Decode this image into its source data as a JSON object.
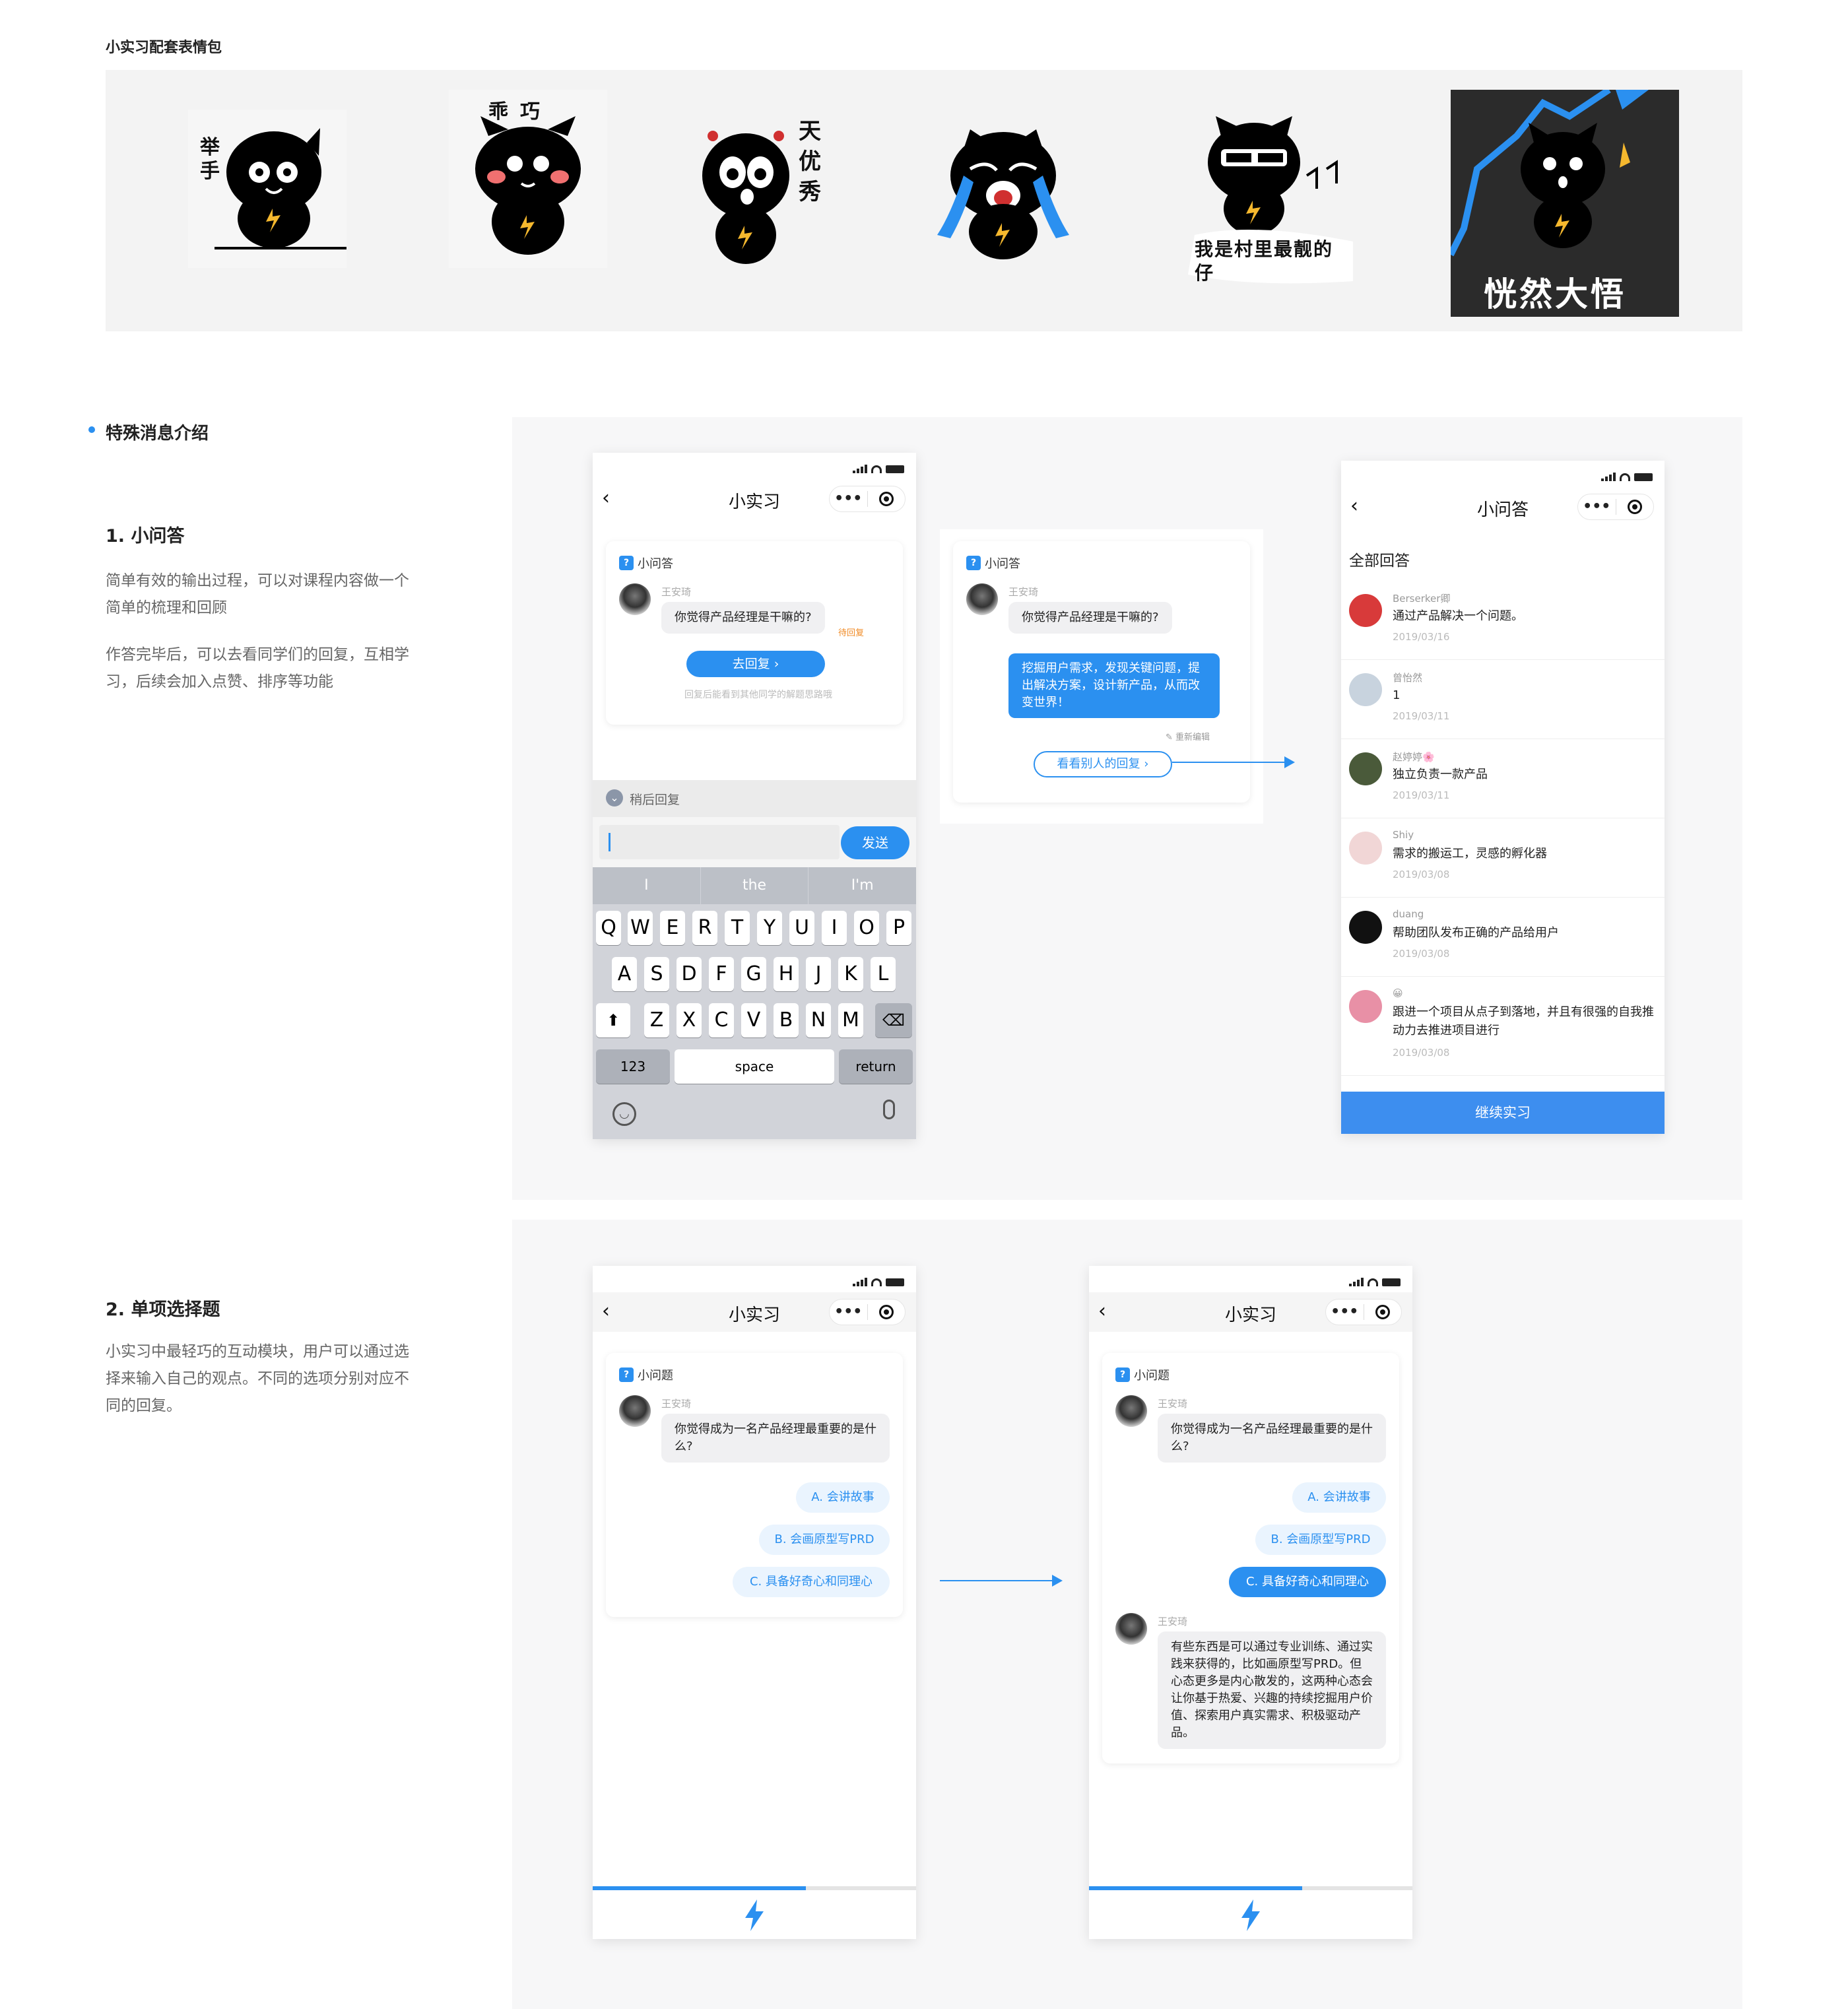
{
  "stickers_section": {
    "title": "小实习配套表情包",
    "captions": [
      "举手",
      "乖巧",
      "天优秀",
      "我是村里最靓的仔",
      "恍然大悟"
    ]
  },
  "special_section": {
    "title": "特殊消息介绍",
    "qa": {
      "heading": "1. 小问答",
      "desc1": "简单有效的输出过程，可以对课程内容做一个简单的梳理和回顾",
      "desc2": "作答完毕后，可以去看同学们的回复，互相学习，后续会加入点赞、排序等功能"
    },
    "choice": {
      "heading": "2. 单项选择题",
      "desc": "小实习中最轻巧的互动模块，用户可以通过选择来输入自己的观点。不同的选项分别对应不同的回复。"
    }
  },
  "phone1": {
    "title": "小实习",
    "card_label": "小问答",
    "teacher": "王安琦",
    "question": "你觉得产品经理是干嘛的?",
    "status_tag": "待回复",
    "reply_button": "去回复",
    "hint": "回复后能看到其他同学的解题思路哦",
    "later_label": "稍后回复",
    "send_button": "发送",
    "suggestions": [
      "I",
      "the",
      "I'm"
    ],
    "row1": [
      "Q",
      "W",
      "E",
      "R",
      "T",
      "Y",
      "U",
      "I",
      "O",
      "P"
    ],
    "row2": [
      "A",
      "S",
      "D",
      "F",
      "G",
      "H",
      "J",
      "K",
      "L"
    ],
    "row3": [
      "Z",
      "X",
      "C",
      "V",
      "B",
      "N",
      "M"
    ],
    "key_123": "123",
    "key_space": "space",
    "key_return": "return"
  },
  "card2": {
    "card_label": "小问答",
    "teacher": "王安琦",
    "question": "你觉得产品经理是干嘛的?",
    "answer": "挖掘用户需求，发现关键问题，提出解决方案，设计新产品，从而改变世界！",
    "edit_label": "重新编辑",
    "view_others_button": "看看别人的回复"
  },
  "phone3": {
    "title": "小问答",
    "section": "全部回答",
    "answers": [
      {
        "name": "Berserker卿",
        "text": "通过产品解决一个问题。",
        "date": "2019/03/16"
      },
      {
        "name": "曾怡然",
        "text": "1",
        "date": "2019/03/11"
      },
      {
        "name": "赵婷婷🌸",
        "text": "独立负责一款产品",
        "date": "2019/03/11"
      },
      {
        "name": "Shiy",
        "text": "需求的搬运工，灵感的孵化器",
        "date": "2019/03/08"
      },
      {
        "name": "duang",
        "text": "帮助团队发布正确的产品给用户",
        "date": "2019/03/08"
      },
      {
        "name": "😀",
        "text": "跟进一个项目从点子到落地，并且有很强的自我推动力去推进项目进行",
        "date": "2019/03/08"
      }
    ],
    "continue_button": "继续实习"
  },
  "phone4": {
    "title": "小实习",
    "card_label": "小问题",
    "teacher": "王安琦",
    "question": "你觉得成为一名产品经理最重要的是什么?",
    "options": [
      "A. 会讲故事",
      "B. 会画原型写PRD",
      "C. 具备好奇心和同理心"
    ],
    "progress": 0.66
  },
  "phone5": {
    "title": "小实习",
    "card_label": "小问题",
    "teacher": "王安琦",
    "question": "你觉得成为一名产品经理最重要的是什么?",
    "options": [
      "A. 会讲故事",
      "B. 会画原型写PRD",
      "C. 具备好奇心和同理心"
    ],
    "selected_index": 2,
    "reply_teacher": "王安琦",
    "reply": "有些东西是可以通过专业训练、通过实践来获得的，比如画原型写PRD。但心态更多是内心散发的，这两种心态会让你基于热爱、兴趣的持续挖掘用户价值、探索用户真实需求、积极驱动产品。",
    "progress": 0.66
  },
  "colors": {
    "accent": "#2b90f0",
    "panel": "#f7f7f8",
    "status_orange": "#f08a24"
  }
}
